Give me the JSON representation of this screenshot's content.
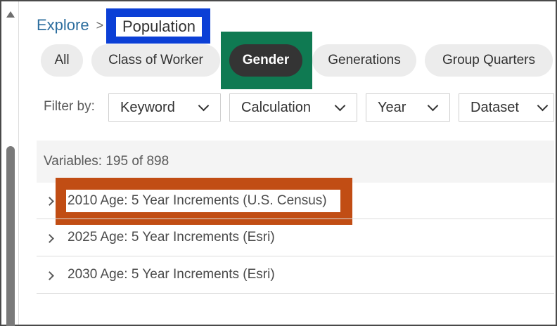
{
  "breadcrumb": {
    "root": "Explore",
    "separator": ">",
    "current": "Population"
  },
  "chips": [
    {
      "label": "All"
    },
    {
      "label": "Class of Worker"
    },
    {
      "label": "Gender"
    },
    {
      "label": "Generations"
    },
    {
      "label": "Group Quarters"
    }
  ],
  "active_chip": "Gender",
  "filter": {
    "label": "Filter by:",
    "dropdowns": [
      {
        "label": "Keyword"
      },
      {
        "label": "Calculation"
      },
      {
        "label": "Year"
      },
      {
        "label": "Dataset"
      }
    ]
  },
  "variables": {
    "summary": "Variables: 195 of 898",
    "rows": [
      {
        "label": "2010 Age: 5 Year Increments (U.S. Census)"
      },
      {
        "label": "2025 Age: 5 Year Increments (Esri)"
      },
      {
        "label": "2030 Age: 5 Year Increments (Esri)"
      }
    ]
  },
  "annotation_colors": {
    "blue": "#0b3fd6",
    "green": "#0f7a52",
    "orange": "#c14d14"
  }
}
